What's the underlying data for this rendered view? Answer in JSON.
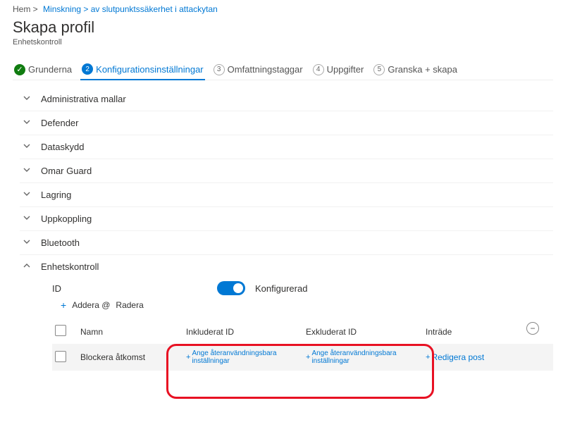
{
  "breadcrumb": {
    "home": "Hem >",
    "path": "Minskning > av slutpunktssäkerhet i attackytan"
  },
  "title": "Skapa profil",
  "subtitle": "Enhetskontroll",
  "steps": {
    "s1": "Grunderna",
    "s2": "Konfigurationsinställningar",
    "s3": "Omfattningstaggar",
    "s4": "Uppgifter",
    "s5": "Granska + skapa",
    "n3": "3",
    "n4": "4",
    "n5": "5"
  },
  "sections": {
    "items": [
      {
        "label": "Administrativa mallar",
        "expanded": false
      },
      {
        "label": "Defender",
        "expanded": false
      },
      {
        "label": "Dataskydd",
        "expanded": false
      },
      {
        "label": "Omar Guard",
        "expanded": false
      },
      {
        "label": "Lagring",
        "expanded": false
      },
      {
        "label": "Uppkoppling",
        "expanded": false
      },
      {
        "label": "Bluetooth",
        "expanded": false
      },
      {
        "label": "Enhetskontroll",
        "expanded": true
      }
    ]
  },
  "detail": {
    "id_label": "ID",
    "toggle_label": "Konfigurerad",
    "add": "Addera @",
    "delete": "Radera"
  },
  "table": {
    "headers": {
      "name": "Namn",
      "included": "Inkluderat ID",
      "excluded": "Exkluderat ID",
      "entry": "Inträde"
    },
    "row": {
      "name": "Blockera åtkomst",
      "included_link": "Ange återanvändningsbara inställningar",
      "excluded_link": "Ange återanvändningsbara inställningar",
      "edit": "Redigera post"
    }
  }
}
